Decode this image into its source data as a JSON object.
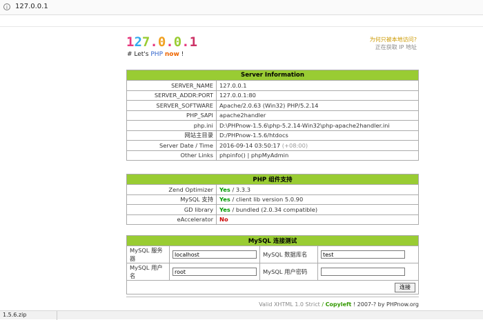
{
  "browser": {
    "url": "127.0.0.1"
  },
  "header": {
    "logo_chars": [
      {
        "c": "1",
        "color": "#e6397e"
      },
      {
        "c": "2",
        "color": "#33aaee"
      },
      {
        "c": "7",
        "color": "#99cc33"
      },
      {
        "c": ".",
        "color": "#e6397e"
      },
      {
        "c": "0",
        "color": "#f0a020"
      },
      {
        "c": ".",
        "color": "#e6397e"
      },
      {
        "c": "0",
        "color": "#99cc33"
      },
      {
        "c": ".",
        "color": "#e6397e"
      },
      {
        "c": "1",
        "color": "#cc3366"
      }
    ],
    "slogan_prefix": "# Let's",
    "slogan_php": "PHP",
    "slogan_now": "now",
    "slogan_suffix": "!",
    "visitor_question": "为何只被本地访问?",
    "visitor_status": "正在获取 IP 地址"
  },
  "server_info": {
    "title": "Server Information",
    "rows": [
      {
        "label": "SERVER_NAME",
        "value": "127.0.0.1"
      },
      {
        "label": "SERVER_ADDR:PORT",
        "value": "127.0.0.1:80"
      },
      {
        "label": "SERVER_SOFTWARE",
        "value": "Apache/2.0.63 (Win32) PHP/5.2.14"
      },
      {
        "label": "PHP_SAPI",
        "value": "apache2handler"
      },
      {
        "label": "php.ini",
        "value": "D:\\PHPnow-1.5.6\\php-5.2.14-Win32\\php-apache2handler.ini"
      },
      {
        "label": "网站主目录",
        "value": "D:/PHPnow-1.5.6/htdocs"
      },
      {
        "label": "Server Date / Time",
        "value": "2016-09-14 03:50:17",
        "tz": "(+08:00)"
      },
      {
        "label": "Other Links",
        "link1": "phpinfo()",
        "link_sep": "|",
        "link2": "phpMyAdmin"
      }
    ]
  },
  "php_components": {
    "title": "PHP 组件支持",
    "rows": [
      {
        "label": "Zend Optimizer",
        "status": "Yes",
        "detail": "/ 3.3.3"
      },
      {
        "label": "MySQL 支持",
        "status": "Yes",
        "detail": "/ client lib version 5.0.90"
      },
      {
        "label": "GD library",
        "status": "Yes",
        "detail": "/ bundled (2.0.34 compatible)"
      },
      {
        "label": "eAccelerator",
        "status": "No",
        "detail": ""
      }
    ]
  },
  "mysql_test": {
    "title": "MySQL 连接测试",
    "server_label": "MySQL 服务器",
    "server_value": "localhost",
    "db_label": "MySQL 数据库名",
    "db_value": "test",
    "user_label": "MySQL 用户名",
    "user_value": "root",
    "pass_label": "MySQL 用户密码",
    "pass_value": "",
    "connect_button": "连接"
  },
  "footer": {
    "valid": "Valid XHTML 1.0 Strict",
    "slash1": "/",
    "copyleft": "Copyleft",
    "year": "! 2007-? by PHPnow.org"
  },
  "download_bar": {
    "file": "1.5.6.zip"
  }
}
